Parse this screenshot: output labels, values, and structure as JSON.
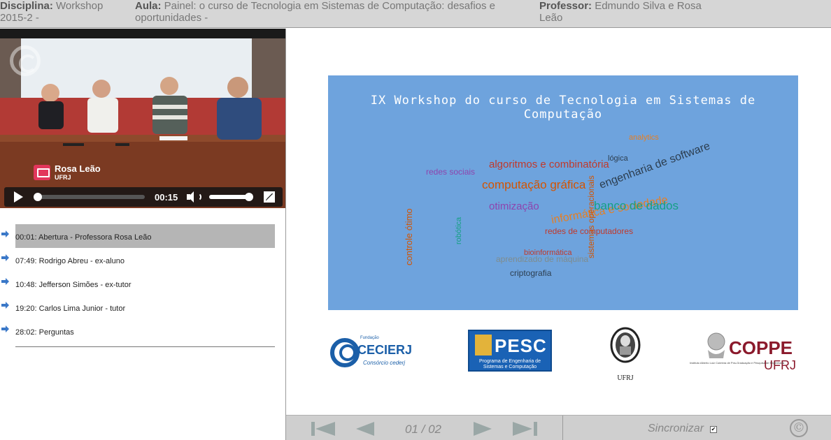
{
  "header": {
    "discipline_label": "Disciplina:",
    "discipline_value": "Workshop 2015-2 -",
    "lesson_label": "Aula:",
    "lesson_value": "Painel: o curso de Tecnologia em Sistemas de Computação: desafios e oportunidades -",
    "teacher_label": "Professor:",
    "teacher_value": "Edmundo Silva e Rosa Leão"
  },
  "video": {
    "speaker_name": "Rosa Leão",
    "speaker_org": "UFRJ",
    "current_time": "00:15",
    "progress": 0.03,
    "volume": 0.95
  },
  "chapters": [
    {
      "label": "00:01: Abertura - Professora Rosa Leão",
      "active": true
    },
    {
      "label": "07:49: Rodrigo Abreu - ex-aluno",
      "active": false
    },
    {
      "label": "10:48: Jefferson Simões - ex-tutor",
      "active": false
    },
    {
      "label": "19:20: Carlos Lima Junior - tutor",
      "active": false
    },
    {
      "label": "28:02: Perguntas",
      "active": false
    }
  ],
  "slide": {
    "title": "IX Workshop do curso de Tecnologia em Sistemas de Computação",
    "cloud_words": [
      "algoritmos e combinatória",
      "computação gráfica",
      "engenharia de software",
      "otimização",
      "informática e sociedade",
      "banco de dados",
      "redes de computadores",
      "aprendizado de máquina",
      "criptografia",
      "controle ótimo",
      "bioinformática",
      "sistemas operacionais",
      "lógica",
      "redes sociais",
      "analytics",
      "robótica"
    ],
    "logos": {
      "cecierj_top": "Fundação",
      "cecierj": "CECIERJ",
      "cecierj_sub": "Consórcio cederj",
      "pesc": "PESC",
      "pesc_sub": "Programa de Engenharia de Sistemas e Computação",
      "ufrj": "UFRJ",
      "coppe": "COPPE",
      "coppe_ufrj": "UFRJ",
      "coppe_sub": "Instituto Alberto Luiz Coimbra de Pós-Graduação e Pesquisa de Engenharia"
    }
  },
  "navbar": {
    "page": "01 / 02",
    "sync_label": "Sincronizar",
    "sync_checked": true,
    "copyright_symbol": "©"
  },
  "colors": {
    "header_bg": "#d6d6d6",
    "banner_bg": "#6ea3dd",
    "active_chapter_bg": "#b5b5b5",
    "navbar_bg": "#cfcfcf",
    "chapter_arrow": "#3a78c8"
  }
}
